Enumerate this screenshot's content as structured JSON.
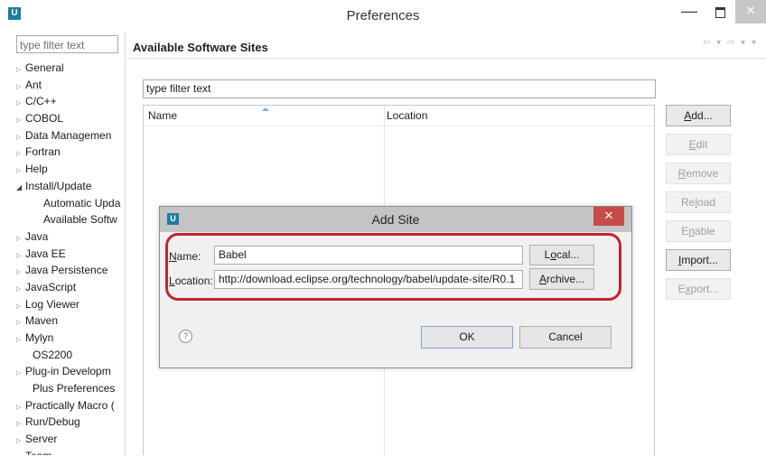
{
  "window": {
    "title": "Preferences",
    "app_icon": "U",
    "min_glyph": "—",
    "close_glyph": "✕"
  },
  "left_panel": {
    "filter_placeholder": "type filter text",
    "tree": [
      {
        "label": "General",
        "kind": "collapsed"
      },
      {
        "label": "Ant",
        "kind": "collapsed"
      },
      {
        "label": "C/C++",
        "kind": "collapsed"
      },
      {
        "label": "COBOL",
        "kind": "collapsed"
      },
      {
        "label": "Data Managemen",
        "kind": "collapsed"
      },
      {
        "label": "Fortran",
        "kind": "collapsed"
      },
      {
        "label": "Help",
        "kind": "collapsed"
      },
      {
        "label": "Install/Update",
        "kind": "expanded"
      },
      {
        "label": "Automatic Upda",
        "kind": "child"
      },
      {
        "label": "Available Softw",
        "kind": "child"
      },
      {
        "label": "Java",
        "kind": "collapsed"
      },
      {
        "label": "Java EE",
        "kind": "collapsed"
      },
      {
        "label": "Java Persistence",
        "kind": "collapsed"
      },
      {
        "label": "JavaScript",
        "kind": "collapsed"
      },
      {
        "label": "Log Viewer",
        "kind": "collapsed"
      },
      {
        "label": "Maven",
        "kind": "collapsed"
      },
      {
        "label": "Mylyn",
        "kind": "collapsed"
      },
      {
        "label": "OS2200",
        "kind": "leaf"
      },
      {
        "label": "Plug-in Developm",
        "kind": "collapsed"
      },
      {
        "label": "Plus Preferences",
        "kind": "leaf"
      },
      {
        "label": "Practically Macro (",
        "kind": "collapsed"
      },
      {
        "label": "Run/Debug",
        "kind": "collapsed"
      },
      {
        "label": "Server",
        "kind": "collapsed"
      },
      {
        "label": "Team",
        "kind": "collapsed"
      }
    ]
  },
  "main": {
    "title": "Available Software Sites",
    "filter_value": "type filter text",
    "columns": {
      "name": "Name",
      "location": "Location"
    },
    "buttons": {
      "add": "Add...",
      "edit": "Edit",
      "remove": "Remove",
      "reload": "Reload",
      "enable": "Enable",
      "import": "Import...",
      "export": "Export..."
    }
  },
  "dialog": {
    "title": "Add Site",
    "icon": "U",
    "close_glyph": "✕",
    "name_label": "Name:",
    "name_value": "Babel",
    "location_label": "Location:",
    "location_value": "http://download.eclipse.org/technology/babel/update-site/R0.1",
    "local_button": "Local...",
    "archive_button": "Archive...",
    "help_glyph": "?",
    "ok_button": "OK",
    "cancel_button": "Cancel"
  },
  "colors": {
    "highlight": "#c52430",
    "dialog_close": "#c74b46",
    "app_icon": "#1a7ea1"
  }
}
